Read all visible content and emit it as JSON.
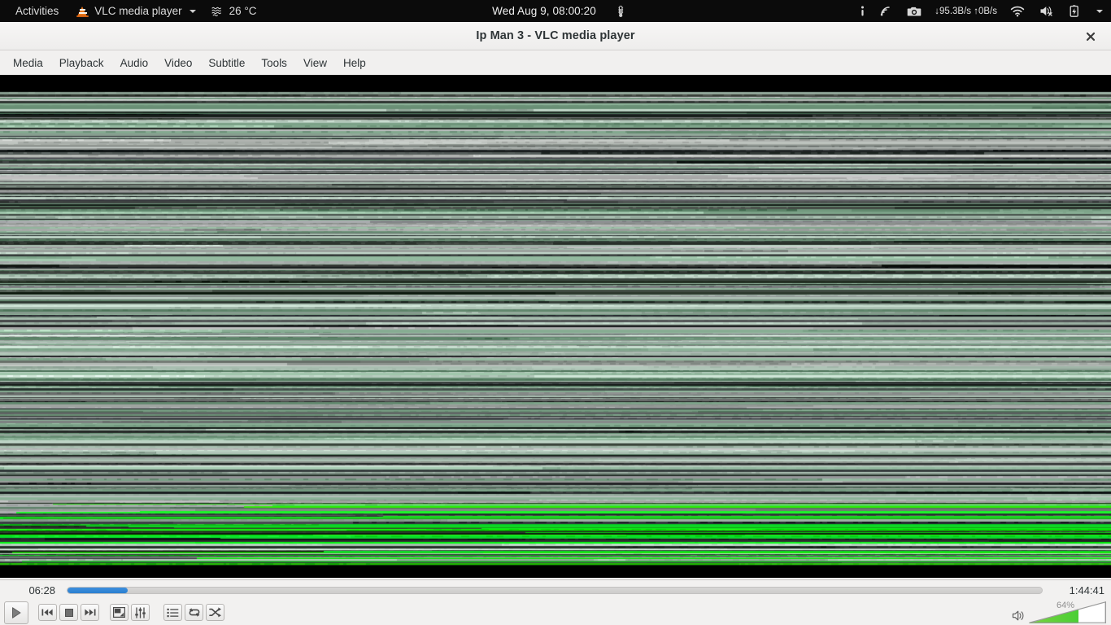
{
  "topbar": {
    "activities": "Activities",
    "app_name": "VLC media player",
    "app_icon": "vlc-cone-icon",
    "weather_icon": "weather-fog-icon",
    "temperature": "26 °C",
    "clock": "Wed Aug  9, 08:00:20",
    "thermometer_icon": "thermometer-icon",
    "info_icon": "info-icon",
    "cast_icon": "network-broadcast-icon",
    "camera_icon": "camera-icon",
    "network_speed": "↓95.3B/s ↑0B/s",
    "wifi_icon": "wifi-icon",
    "volume_icon": "volume-muted-icon",
    "battery_icon": "battery-charging-icon",
    "menu_caret_icon": "chevron-down-icon"
  },
  "window": {
    "title": "Ip Man 3 - VLC media player",
    "close_label": "✕"
  },
  "menubar": {
    "items": [
      {
        "label": "Media"
      },
      {
        "label": "Playback"
      },
      {
        "label": "Audio"
      },
      {
        "label": "Video"
      },
      {
        "label": "Subtitle"
      },
      {
        "label": "Tools"
      },
      {
        "label": "View"
      },
      {
        "label": "Help"
      }
    ]
  },
  "video": {
    "state": "corrupted-frame",
    "description": "Glitched horizontal scanline artifacts, green and gray bands"
  },
  "controls": {
    "elapsed": "06:28",
    "total": "1:44:41",
    "progress_percent": 6.2,
    "buttons": [
      {
        "name": "play-button",
        "label": "Play"
      },
      {
        "name": "previous-button",
        "label": "Previous"
      },
      {
        "name": "stop-button",
        "label": "Stop"
      },
      {
        "name": "next-button",
        "label": "Next"
      },
      {
        "name": "fullscreen-button",
        "label": "Toggle fullscreen"
      },
      {
        "name": "extended-settings-button",
        "label": "Show extended settings"
      },
      {
        "name": "playlist-button",
        "label": "Show playlist"
      },
      {
        "name": "loop-button",
        "label": "Loop"
      },
      {
        "name": "shuffle-button",
        "label": "Random"
      }
    ],
    "volume_percent": "64%",
    "volume_value": 64,
    "volume_icon": "speaker-icon"
  },
  "colors": {
    "accent_blue": "#2f80d0",
    "volume_green": "#2fcc2f",
    "vlc_orange": "#e8761a",
    "topbar_bg": "#0b0b0b",
    "chrome_bg": "#f2f1f0"
  }
}
